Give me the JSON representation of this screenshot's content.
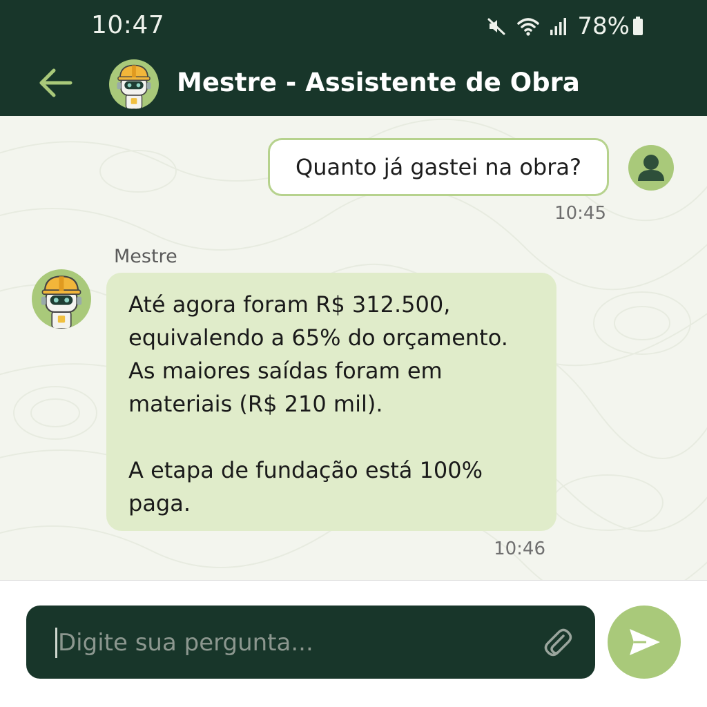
{
  "status_bar": {
    "time": "10:47",
    "battery": "78%",
    "icons": [
      "mute-icon",
      "wifi-icon",
      "signal-icon",
      "battery-icon"
    ]
  },
  "header": {
    "title": "Mestre - Assistente de Obra",
    "back_icon": "arrow-left-icon",
    "avatar": "construction-robot-avatar"
  },
  "messages": [
    {
      "sender": "user",
      "text": "Quanto já gastei na obra?",
      "time": "10:45"
    },
    {
      "sender": "bot",
      "name": "Mestre",
      "paragraphs": [
        "Até agora foram R$ 312.500, equivalendo a 65% do orçamento. As maiores saídas foram em materiais (R$ 210 mil).",
        "A etapa de fundação está 100% paga."
      ],
      "time": "10:46"
    }
  ],
  "input": {
    "placeholder": "Digite sua pergunta...",
    "value": "",
    "attach_icon": "paperclip-icon",
    "send_icon": "send-icon"
  },
  "colors": {
    "header_bg": "#18362a",
    "accent": "#a9c97a",
    "bot_bubble": "#e0ecca",
    "user_bubble_border": "#b6d28d",
    "chat_bg": "#f3f5ee"
  }
}
